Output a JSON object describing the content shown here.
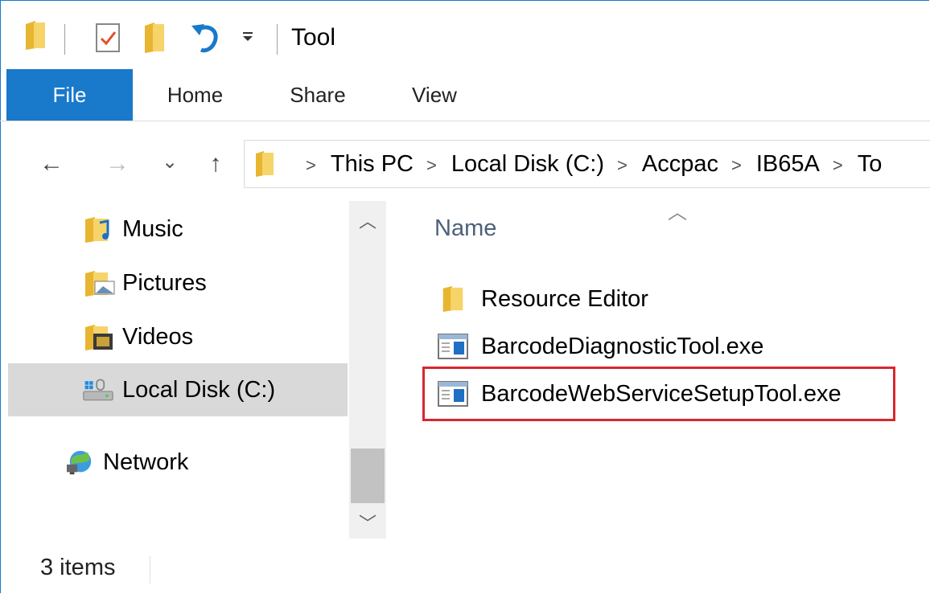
{
  "window": {
    "title": "Tool"
  },
  "quick_access": {
    "icons": [
      "folder-icon",
      "properties-icon",
      "new-folder-icon",
      "undo-icon",
      "customize-dropdown-icon"
    ]
  },
  "ribbon": {
    "tabs": [
      {
        "label": "File",
        "active": true
      },
      {
        "label": "Home"
      },
      {
        "label": "Share"
      },
      {
        "label": "View"
      }
    ]
  },
  "navigation": {
    "back": "←",
    "forward": "→",
    "recent": "⌄",
    "up": "↑",
    "breadcrumb": [
      "This PC",
      "Local Disk (C:)",
      "Accpac",
      "IB65A",
      "To"
    ]
  },
  "nav_pane": {
    "items": [
      {
        "label": "Music",
        "icon": "music-folder-icon"
      },
      {
        "label": "Pictures",
        "icon": "pictures-folder-icon"
      },
      {
        "label": "Videos",
        "icon": "videos-folder-icon"
      },
      {
        "label": "Local Disk (C:)",
        "icon": "local-disk-icon",
        "selected": true
      },
      {
        "label": "Network",
        "icon": "network-icon"
      }
    ]
  },
  "content": {
    "column_header": "Name",
    "files": [
      {
        "name": "Resource Editor",
        "icon": "folder-icon"
      },
      {
        "name": "BarcodeDiagnosticTool.exe",
        "icon": "exe-icon"
      },
      {
        "name": "BarcodeWebServiceSetupTool.exe",
        "icon": "exe-icon",
        "highlighted": true
      }
    ]
  },
  "status_bar": {
    "item_count": "3 items"
  },
  "colors": {
    "accent": "#1979ca",
    "highlight_box": "#d9272e",
    "selected_bg": "#d9d9d9"
  }
}
